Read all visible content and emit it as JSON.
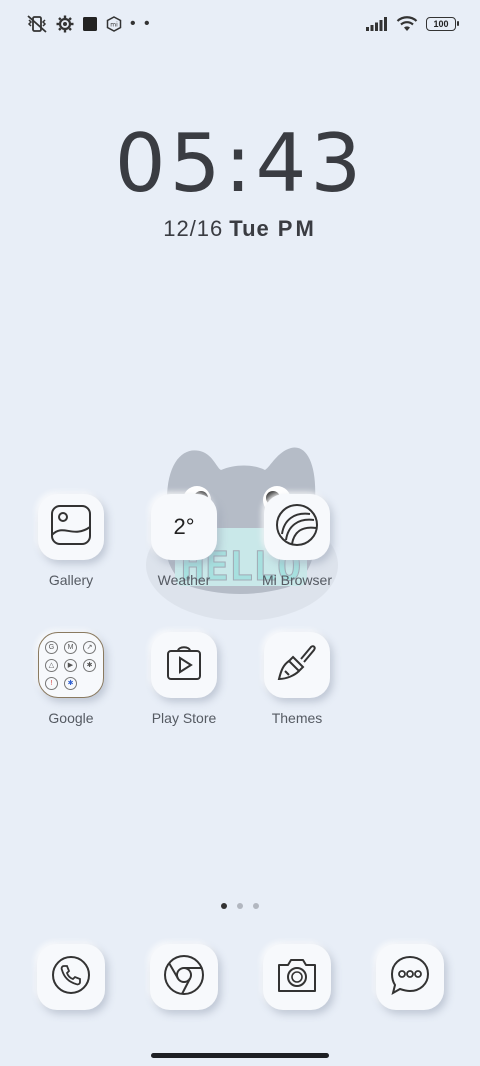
{
  "status_bar": {
    "icons_left": [
      "vibrate-off-icon",
      "settings-icon",
      "square-icon",
      "mi-icon"
    ],
    "more_dots": "• •",
    "icons_right": [
      "signal-icon",
      "wifi-icon"
    ],
    "battery": "100"
  },
  "clock": {
    "time": "05:43",
    "date": "12/16",
    "day": "Tue",
    "ampm": "PM"
  },
  "apps_row1": [
    {
      "label": "Gallery",
      "icon": "gallery-icon"
    },
    {
      "label": "Weather",
      "icon": "weather-icon",
      "value": "2°"
    },
    {
      "label": "Mi Browser",
      "icon": "mi-browser-icon"
    }
  ],
  "apps_row2": [
    {
      "label": "Google",
      "icon": "google-folder-icon"
    },
    {
      "label": "Play Store",
      "icon": "play-store-icon"
    },
    {
      "label": "Themes",
      "icon": "themes-brush-icon"
    }
  ],
  "pager": {
    "pages": 3,
    "active": 1
  },
  "dock": [
    {
      "icon": "phone-icon"
    },
    {
      "icon": "chrome-icon"
    },
    {
      "icon": "camera-icon"
    },
    {
      "icon": "messages-icon"
    }
  ],
  "widget": {
    "text": "HELLO",
    "icon": "cat-widget-icon"
  }
}
